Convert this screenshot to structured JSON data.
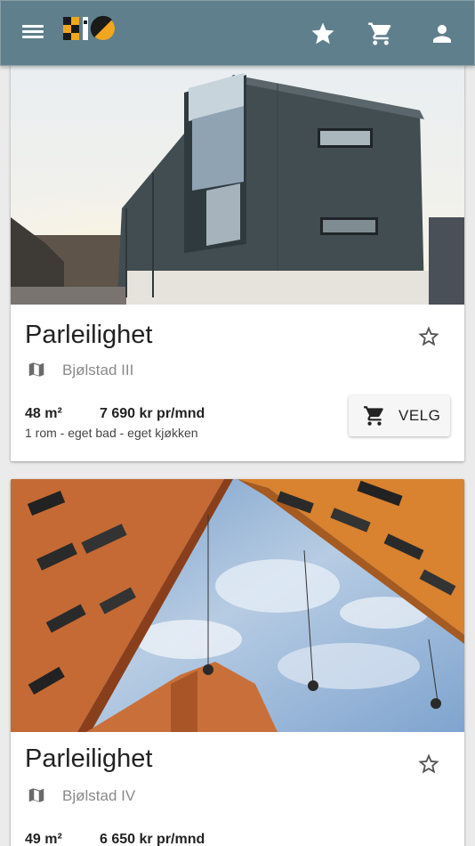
{
  "appbar": {
    "menu_icon": "menu-icon",
    "logo": "brand-logo",
    "favorites_icon": "star-icon",
    "cart_icon": "cart-icon",
    "account_icon": "person-icon",
    "background": "#5f7f8c"
  },
  "listings": [
    {
      "title": "Parleilighet",
      "location": "Bjølstad III",
      "size": "48 m²",
      "price": "7 690 kr pr/mnd",
      "description": "1 rom - eget bad - eget kjøkken",
      "select_label": "VELG",
      "favorite_icon": "star-outline-icon",
      "location_icon": "map-icon"
    },
    {
      "title": "Parleilighet",
      "location": "Bjølstad IV",
      "size": "49 m²",
      "price": "6 650 kr pr/mnd",
      "favorite_icon": "star-outline-icon",
      "location_icon": "map-icon"
    }
  ]
}
